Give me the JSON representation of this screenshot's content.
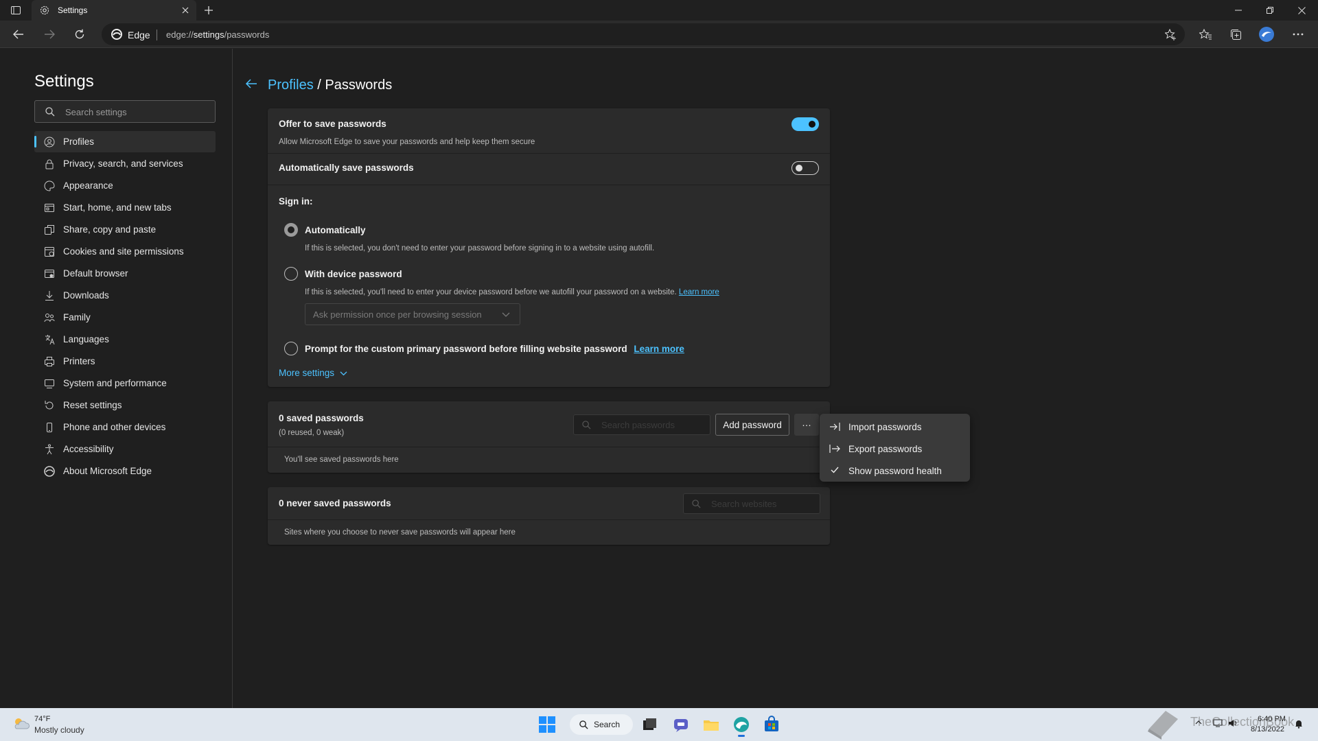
{
  "browser": {
    "tab_title": "Settings",
    "address_label": "Edge",
    "url_prefix": "edge://",
    "url_bold": "settings",
    "url_rest": "/passwords"
  },
  "sidebar": {
    "title": "Settings",
    "search_placeholder": "Search settings",
    "items": [
      {
        "label": "Profiles",
        "icon": "profile-icon"
      },
      {
        "label": "Privacy, search, and services",
        "icon": "lock-icon"
      },
      {
        "label": "Appearance",
        "icon": "appearance-icon"
      },
      {
        "label": "Start, home, and new tabs",
        "icon": "home-tabs-icon"
      },
      {
        "label": "Share, copy and paste",
        "icon": "share-icon"
      },
      {
        "label": "Cookies and site permissions",
        "icon": "cookies-icon"
      },
      {
        "label": "Default browser",
        "icon": "browser-icon"
      },
      {
        "label": "Downloads",
        "icon": "download-icon"
      },
      {
        "label": "Family",
        "icon": "family-icon"
      },
      {
        "label": "Languages",
        "icon": "languages-icon"
      },
      {
        "label": "Printers",
        "icon": "printer-icon"
      },
      {
        "label": "System and performance",
        "icon": "system-icon"
      },
      {
        "label": "Reset settings",
        "icon": "reset-icon"
      },
      {
        "label": "Phone and other devices",
        "icon": "phone-icon"
      },
      {
        "label": "Accessibility",
        "icon": "accessibility-icon"
      },
      {
        "label": "About Microsoft Edge",
        "icon": "edge-icon"
      }
    ]
  },
  "breadcrumb": {
    "parent": "Profiles",
    "separator": "/",
    "current": "Passwords"
  },
  "settings": {
    "offer_title": "Offer to save passwords",
    "offer_desc": "Allow Microsoft Edge to save your passwords and help keep them secure",
    "offer_on": true,
    "auto_title": "Automatically save passwords",
    "auto_on": false,
    "signin_label": "Sign in:",
    "opt_auto_title": "Automatically",
    "opt_auto_desc": "If this is selected, you don't need to enter your password before signing in to a website using autofill.",
    "opt_device_title": "With device password",
    "opt_device_desc": "If this is selected, you'll need to enter your device password before we autofill your password on a website.",
    "learn_more": "Learn more",
    "device_select_value": "Ask permission once per browsing session",
    "opt_custom_title": "Prompt for the custom primary password before filling website password",
    "more_settings": "More settings"
  },
  "saved": {
    "title": "0 saved passwords",
    "subtitle": "(0 reused, 0 weak)",
    "search_placeholder": "Search passwords",
    "add_button": "Add password",
    "more_button": "···",
    "empty_text": "You'll see saved passwords here"
  },
  "never_saved": {
    "title": "0 never saved passwords",
    "search_placeholder": "Search websites",
    "empty_text": "Sites where you choose to never save passwords will appear here"
  },
  "context_menu": {
    "items": [
      {
        "label": "Import passwords",
        "icon": "import-icon"
      },
      {
        "label": "Export passwords",
        "icon": "export-icon"
      },
      {
        "label": "Show password health",
        "icon": "checkmark-icon"
      }
    ]
  },
  "taskbar": {
    "temperature": "74°F",
    "condition": "Mostly cloudy",
    "search_label": "Search",
    "time": "6:40 PM",
    "date": "8/13/2022",
    "watermark": "TheCollectionBook"
  },
  "colors": {
    "accent": "#4cc2ff",
    "background": "#1f1f1f",
    "card": "#2b2b2b"
  }
}
